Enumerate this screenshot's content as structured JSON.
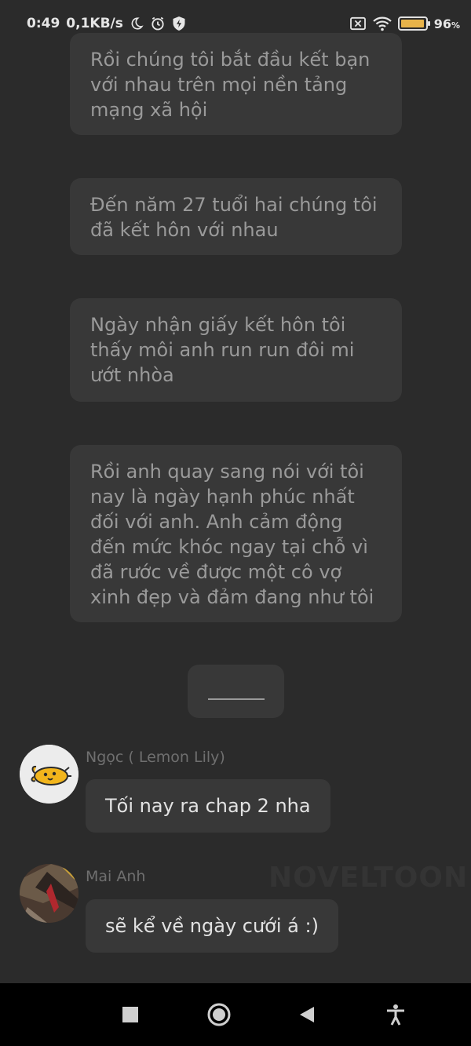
{
  "status_bar": {
    "time": "0:49",
    "speed": "0,1KB/s",
    "battery_percent": "96",
    "battery_unit": "%",
    "battery_level": 0.96,
    "icons": [
      "moon-icon",
      "alarm-icon",
      "shield-icon",
      "sim-x-icon",
      "wifi-icon",
      "battery-icon"
    ]
  },
  "narration": [
    {
      "text": "Rồi chúng tôi bắt đầu kết bạn với nhau trên mọi nền tảng mạng xã hội"
    },
    {
      "text": "Đến năm 27 tuổi hai chúng tôi đã kết hôn với nhau"
    },
    {
      "text": "Ngày nhận giấy kết hôn tôi thấy môi anh run run đôi mi ướt nhòa"
    },
    {
      "text": "Rồi anh quay sang nói với tôi nay là ngày hạnh phúc nhất đối với anh. Anh cảm động đến mức khóc ngay tại chỗ vì đã rước về được một cô vợ xinh đẹp và đảm đang như tôi"
    }
  ],
  "messages": [
    {
      "speaker": "Ngọc ( Lemon Lily)",
      "text": "Tối nay ra chap 2 nha"
    },
    {
      "speaker": "Mai Anh",
      "text": "sẽ kể về ngày cưới á :)"
    }
  ],
  "watermark": "NOVELTOON",
  "colors": {
    "background": "#2b2b2b",
    "bubble": "#383838",
    "narration_text": "#9a9a9a",
    "chat_text": "#e2e2e2",
    "battery_fill": "#e7b34a"
  },
  "nav_bar": {
    "buttons": [
      "recents-square-icon",
      "home-circle-icon",
      "back-triangle-icon",
      "accessibility-icon"
    ]
  }
}
